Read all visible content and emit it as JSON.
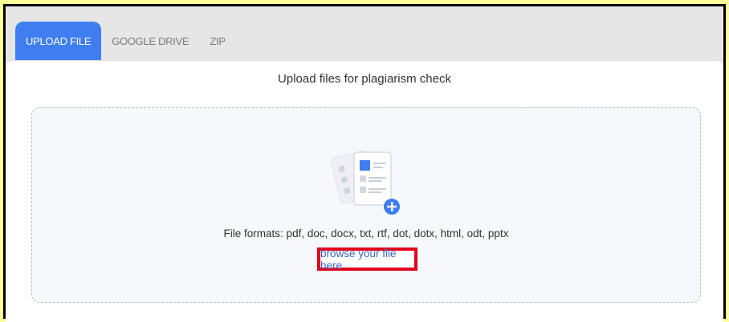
{
  "tabs": [
    {
      "label": "UPLOAD FILE",
      "active": true
    },
    {
      "label": "GOOGLE DRIVE",
      "active": false
    },
    {
      "label": "ZIP",
      "active": false
    }
  ],
  "panel": {
    "title": "Upload files for plagiarism check",
    "formats_text": "File formats: pdf, doc, docx, txt, rtf, dot, dotx, html, odt, pptx",
    "browse_label": "browse your file here"
  },
  "colors": {
    "page_bg": "#ffff99",
    "accent": "#3f7ef1",
    "highlight_box": "#e3001b",
    "link": "#3a66c9"
  }
}
